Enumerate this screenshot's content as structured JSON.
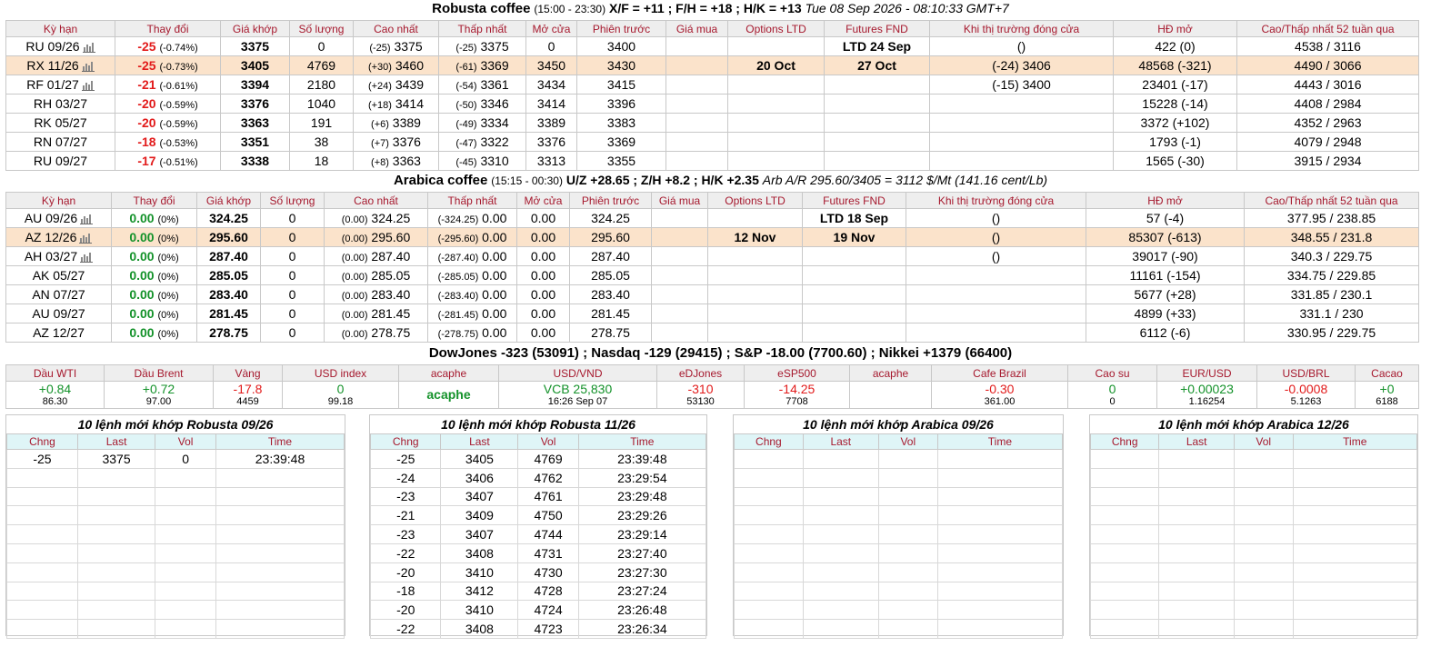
{
  "headers_main": [
    "Kỳ hạn",
    "Thay đổi",
    "Giá khớp",
    "Số lượng",
    "Cao nhất",
    "Thấp nhất",
    "Mở cửa",
    "Phiên trước",
    "Giá mua",
    "Options LTD",
    "Futures FND",
    "Khi thị trường đóng cửa",
    "HĐ mở",
    "Cao/Thấp nhất 52 tuần qua"
  ],
  "robusta": {
    "title": {
      "name": "Robusta coffee",
      "session": "(15:00 - 23:30)",
      "spreads": "X/F = +11 ; F/H = +18 ; H/K = +13",
      "time": "Tue 08 Sep 2026 - 08:10:33 GMT+7"
    },
    "rows": [
      {
        "sym": "RU 09/26",
        "chart": true,
        "chg": "-25",
        "pct": "(-0.74%)",
        "last": "3375",
        "vol": "0",
        "high_chg": "(-25)",
        "high": "3375",
        "low_chg": "(-25)",
        "low": "3375",
        "open": "0",
        "prev": "3400",
        "bid": "",
        "opt_ltd": "",
        "fut_fnd": "LTD 24 Sep",
        "close_chg": "",
        "close": "()",
        "oi": "422 (0)",
        "wk52": "4538 / 3116",
        "hl": false
      },
      {
        "sym": "RX 11/26",
        "chart": true,
        "chg": "-25",
        "pct": "(-0.73%)",
        "last": "3405",
        "vol": "4769",
        "high_chg": "(+30)",
        "high": "3460",
        "low_chg": "(-61)",
        "low": "3369",
        "open": "3450",
        "prev": "3430",
        "bid": "",
        "opt_ltd": "20 Oct",
        "fut_fnd": "27 Oct",
        "close_chg": "(-24)",
        "close": "3406",
        "oi": "48568 (-321)",
        "wk52": "4490 / 3066",
        "hl": true
      },
      {
        "sym": "RF 01/27",
        "chart": true,
        "chg": "-21",
        "pct": "(-0.61%)",
        "last": "3394",
        "vol": "2180",
        "high_chg": "(+24)",
        "high": "3439",
        "low_chg": "(-54)",
        "low": "3361",
        "open": "3434",
        "prev": "3415",
        "bid": "",
        "opt_ltd": "",
        "fut_fnd": "",
        "close_chg": "(-15)",
        "close": "3400",
        "oi": "23401 (-17)",
        "wk52": "4443 / 3016",
        "hl": false
      },
      {
        "sym": "RH 03/27",
        "chart": false,
        "chg": "-20",
        "pct": "(-0.59%)",
        "last": "3376",
        "vol": "1040",
        "high_chg": "(+18)",
        "high": "3414",
        "low_chg": "(-50)",
        "low": "3346",
        "open": "3414",
        "prev": "3396",
        "bid": "",
        "opt_ltd": "",
        "fut_fnd": "",
        "close_chg": "",
        "close": "",
        "oi": "15228 (-14)",
        "wk52": "4408 / 2984",
        "hl": false
      },
      {
        "sym": "RK 05/27",
        "chart": false,
        "chg": "-20",
        "pct": "(-0.59%)",
        "last": "3363",
        "vol": "191",
        "high_chg": "(+6)",
        "high": "3389",
        "low_chg": "(-49)",
        "low": "3334",
        "open": "3389",
        "prev": "3383",
        "bid": "",
        "opt_ltd": "",
        "fut_fnd": "",
        "close_chg": "",
        "close": "",
        "oi": "3372 (+102)",
        "wk52": "4352 / 2963",
        "hl": false
      },
      {
        "sym": "RN 07/27",
        "chart": false,
        "chg": "-18",
        "pct": "(-0.53%)",
        "last": "3351",
        "vol": "38",
        "high_chg": "(+7)",
        "high": "3376",
        "low_chg": "(-47)",
        "low": "3322",
        "open": "3376",
        "prev": "3369",
        "bid": "",
        "opt_ltd": "",
        "fut_fnd": "",
        "close_chg": "",
        "close": "",
        "oi": "1793 (-1)",
        "wk52": "4079 / 2948",
        "hl": false
      },
      {
        "sym": "RU 09/27",
        "chart": false,
        "chg": "-17",
        "pct": "(-0.51%)",
        "last": "3338",
        "vol": "18",
        "high_chg": "(+8)",
        "high": "3363",
        "low_chg": "(-45)",
        "low": "3310",
        "open": "3313",
        "prev": "3355",
        "bid": "",
        "opt_ltd": "",
        "fut_fnd": "",
        "close_chg": "",
        "close": "",
        "oi": "1565 (-30)",
        "wk52": "3915 / 2934",
        "hl": false
      }
    ]
  },
  "arabica": {
    "title": {
      "name": "Arabica coffee",
      "session": "(15:15 - 00:30)",
      "spreads": "U/Z +28.65 ; Z/H +8.2 ; H/K +2.35",
      "arb": "Arb A/R 295.60/3405 = 3112 $/Mt (141.16 cent/Lb)"
    },
    "rows": [
      {
        "sym": "AU 09/26",
        "chart": true,
        "chg": "0.00",
        "pct": "(0%)",
        "last": "324.25",
        "vol": "0",
        "high_chg": "(0.00)",
        "high": "324.25",
        "low_chg": "(-324.25)",
        "low": "0.00",
        "open": "0.00",
        "prev": "324.25",
        "bid": "",
        "opt_ltd": "",
        "fut_fnd": "LTD 18 Sep",
        "close": "()",
        "oi": "57 (-4)",
        "wk52": "377.95 / 238.85",
        "hl": false
      },
      {
        "sym": "AZ 12/26",
        "chart": true,
        "chg": "0.00",
        "pct": "(0%)",
        "last": "295.60",
        "vol": "0",
        "high_chg": "(0.00)",
        "high": "295.60",
        "low_chg": "(-295.60)",
        "low": "0.00",
        "open": "0.00",
        "prev": "295.60",
        "bid": "",
        "opt_ltd": "12 Nov",
        "fut_fnd": "19 Nov",
        "close": "()",
        "oi": "85307 (-613)",
        "wk52": "348.55 / 231.8",
        "hl": true
      },
      {
        "sym": "AH 03/27",
        "chart": true,
        "chg": "0.00",
        "pct": "(0%)",
        "last": "287.40",
        "vol": "0",
        "high_chg": "(0.00)",
        "high": "287.40",
        "low_chg": "(-287.40)",
        "low": "0.00",
        "open": "0.00",
        "prev": "287.40",
        "bid": "",
        "opt_ltd": "",
        "fut_fnd": "",
        "close": "()",
        "oi": "39017 (-90)",
        "wk52": "340.3 / 229.75",
        "hl": false
      },
      {
        "sym": "AK 05/27",
        "chart": false,
        "chg": "0.00",
        "pct": "(0%)",
        "last": "285.05",
        "vol": "0",
        "high_chg": "(0.00)",
        "high": "285.05",
        "low_chg": "(-285.05)",
        "low": "0.00",
        "open": "0.00",
        "prev": "285.05",
        "bid": "",
        "opt_ltd": "",
        "fut_fnd": "",
        "close": "",
        "oi": "11161 (-154)",
        "wk52": "334.75 / 229.85",
        "hl": false
      },
      {
        "sym": "AN 07/27",
        "chart": false,
        "chg": "0.00",
        "pct": "(0%)",
        "last": "283.40",
        "vol": "0",
        "high_chg": "(0.00)",
        "high": "283.40",
        "low_chg": "(-283.40)",
        "low": "0.00",
        "open": "0.00",
        "prev": "283.40",
        "bid": "",
        "opt_ltd": "",
        "fut_fnd": "",
        "close": "",
        "oi": "5677 (+28)",
        "wk52": "331.85 / 230.1",
        "hl": false
      },
      {
        "sym": "AU 09/27",
        "chart": false,
        "chg": "0.00",
        "pct": "(0%)",
        "last": "281.45",
        "vol": "0",
        "high_chg": "(0.00)",
        "high": "281.45",
        "low_chg": "(-281.45)",
        "low": "0.00",
        "open": "0.00",
        "prev": "281.45",
        "bid": "",
        "opt_ltd": "",
        "fut_fnd": "",
        "close": "",
        "oi": "4899 (+33)",
        "wk52": "331.1 / 230",
        "hl": false
      },
      {
        "sym": "AZ 12/27",
        "chart": false,
        "chg": "0.00",
        "pct": "(0%)",
        "last": "278.75",
        "vol": "0",
        "high_chg": "(0.00)",
        "high": "278.75",
        "low_chg": "(-278.75)",
        "low": "0.00",
        "open": "0.00",
        "prev": "278.75",
        "bid": "",
        "opt_ltd": "",
        "fut_fnd": "",
        "close": "",
        "oi": "6112 (-6)",
        "wk52": "330.95 / 229.75",
        "hl": false
      }
    ]
  },
  "indices": {
    "text": "DowJones -323 (53091) ; Nasdaq -129 (29415) ; S&P -18.00 (7700.60) ; Nikkei +1379 (66400)"
  },
  "markets": [
    {
      "label": "Dầu WTI",
      "change": "+0.84",
      "base": "86.30",
      "dir": "up"
    },
    {
      "label": "Dầu Brent",
      "change": "+0.72",
      "base": "97.00",
      "dir": "up"
    },
    {
      "label": "Vàng",
      "change": "-17.8",
      "base": "4459",
      "dir": "down"
    },
    {
      "label": "USD index",
      "change": "0",
      "base": "99.18",
      "dir": "up"
    },
    {
      "label": "acaphe",
      "change": "acaphe",
      "base": "",
      "dir": "logo"
    },
    {
      "label": "USD/VND",
      "change": "VCB 25,830",
      "base": "16:26 Sep 07",
      "dir": "up"
    },
    {
      "label": "eDJones",
      "change": "-310",
      "base": "53130",
      "dir": "down"
    },
    {
      "label": "eSP500",
      "change": "-14.25",
      "base": "7708",
      "dir": "down"
    },
    {
      "label": "acaphe",
      "change": "",
      "base": "",
      "dir": "logo"
    },
    {
      "label": "Cafe Brazil",
      "change": "-0.30",
      "base": "361.00",
      "dir": "down"
    },
    {
      "label": "Cao su",
      "change": "0",
      "base": "0",
      "dir": "up"
    },
    {
      "label": "EUR/USD",
      "change": "+0.00023",
      "base": "1.16254",
      "dir": "up"
    },
    {
      "label": "USD/BRL",
      "change": "-0.0008",
      "base": "5.1263",
      "dir": "down"
    },
    {
      "label": "Cacao",
      "change": "+0",
      "base": "6188",
      "dir": "up"
    }
  ],
  "trades_headers": [
    "Chng",
    "Last",
    "Vol",
    "Time"
  ],
  "trades": [
    {
      "title": "10 lệnh mới khớp Robusta 09/26",
      "rows": [
        {
          "chng": "-25",
          "last": "3375",
          "vol": "0",
          "time": "23:39:48"
        }
      ]
    },
    {
      "title": "10 lệnh mới khớp Robusta 11/26",
      "rows": [
        {
          "chng": "-25",
          "last": "3405",
          "vol": "4769",
          "time": "23:39:48"
        },
        {
          "chng": "-24",
          "last": "3406",
          "vol": "4762",
          "time": "23:29:54"
        },
        {
          "chng": "-23",
          "last": "3407",
          "vol": "4761",
          "time": "23:29:48"
        },
        {
          "chng": "-21",
          "last": "3409",
          "vol": "4750",
          "time": "23:29:26"
        },
        {
          "chng": "-23",
          "last": "3407",
          "vol": "4744",
          "time": "23:29:14"
        },
        {
          "chng": "-22",
          "last": "3408",
          "vol": "4731",
          "time": "23:27:40"
        },
        {
          "chng": "-20",
          "last": "3410",
          "vol": "4730",
          "time": "23:27:30"
        },
        {
          "chng": "-18",
          "last": "3412",
          "vol": "4728",
          "time": "23:27:24"
        },
        {
          "chng": "-20",
          "last": "3410",
          "vol": "4724",
          "time": "23:26:48"
        },
        {
          "chng": "-22",
          "last": "3408",
          "vol": "4723",
          "time": "23:26:34"
        }
      ]
    },
    {
      "title": "10 lệnh mới khớp Arabica 09/26",
      "rows": []
    },
    {
      "title": "10 lệnh mới khớp Arabica 12/26",
      "rows": []
    }
  ],
  "colors": {
    "header_text": "#a6192e",
    "header_bg": "#eeeeee",
    "highlight_row": "#fbe3cb",
    "negative": "#e21b1b",
    "positive": "#14922a",
    "trade_header_bg": "#dff5f7"
  },
  "icons": {
    "chart": "bar-chart-icon"
  }
}
